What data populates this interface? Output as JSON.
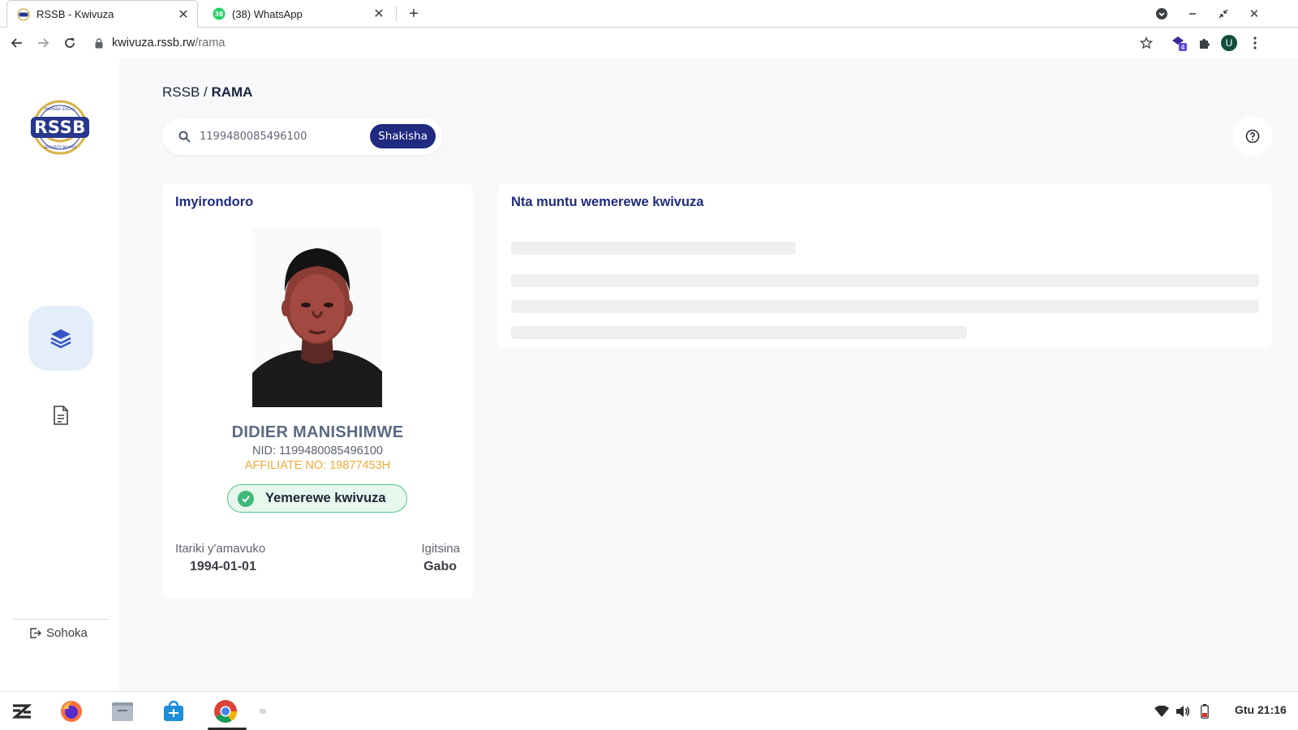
{
  "browser": {
    "tabs": [
      {
        "title": "RSSB - Kwivuza",
        "active": true,
        "favicon": "rssb-favicon"
      },
      {
        "title": "(38) WhatsApp",
        "active": false,
        "favicon": "whatsapp-favicon",
        "badge": "38"
      }
    ],
    "url_host": "kwivuza.rssb.rw",
    "url_path": "/rama",
    "extension_badge": "4",
    "profile_initial": "U"
  },
  "sidebar": {
    "logo_text": "RSSB",
    "logo_ring_text": "RWANDA SOCIAL SECURITY BOARD",
    "items": [
      {
        "name": "layers",
        "active": true
      },
      {
        "name": "document",
        "active": false
      }
    ],
    "logout_label": "Sohoka"
  },
  "breadcrumb": {
    "root": "RSSB",
    "separator": " / ",
    "current": "RAMA"
  },
  "search": {
    "value": "1199480085496100",
    "button_label": "Shakisha"
  },
  "profile_card": {
    "title": "Imyirondoro",
    "name": "DIDIER MANISHIMWE",
    "nid": "NID: 1199480085496100",
    "affiliate": "AFFILIATE NO: 19877453H",
    "status": "Yemerewe kwivuza",
    "dob_label": "Itariki y'amavuko",
    "dob_value": "1994-01-01",
    "sex_label": "Igitsina",
    "sex_value": "Gabo"
  },
  "main_card": {
    "title": "Nta muntu wemerewe kwivuza"
  },
  "taskbar": {
    "clock": "Gtu 21:16"
  },
  "colors": {
    "brand_navy": "#1f2a80",
    "affiliate_orange": "#f0a93a",
    "status_green": "#3fb87a",
    "nav_active_bg": "#e4eefb"
  }
}
